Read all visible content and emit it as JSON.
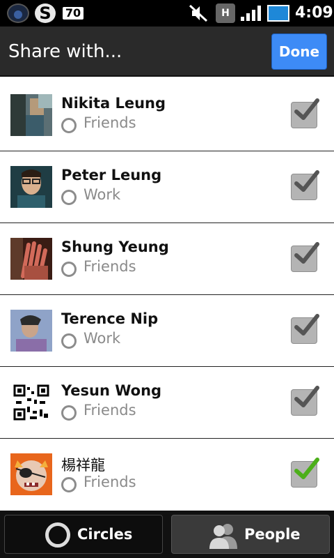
{
  "status_bar": {
    "s_icon": "S",
    "badge": "70",
    "mute_icon": "mute-icon",
    "h_label": "H",
    "time": "4:09"
  },
  "header": {
    "title": "Share with...",
    "done_label": "Done"
  },
  "contacts": [
    {
      "name": "Nikita Leung",
      "circle": "Friends",
      "checked": true,
      "check_color": "#555555"
    },
    {
      "name": "Peter Leung",
      "circle": "Work",
      "checked": true,
      "check_color": "#555555"
    },
    {
      "name": "Shung Yeung",
      "circle": "Friends",
      "checked": true,
      "check_color": "#555555"
    },
    {
      "name": "Terence Nip",
      "circle": "Work",
      "checked": true,
      "check_color": "#555555"
    },
    {
      "name": "Yesun Wong",
      "circle": "Friends",
      "checked": true,
      "check_color": "#555555"
    },
    {
      "name": "楊祥龍",
      "circle": "Friends",
      "checked": true,
      "check_color": "#4caf1a"
    }
  ],
  "tabs": {
    "circles_label": "Circles",
    "people_label": "People"
  },
  "colors": {
    "accent_done": "#3d8bf6",
    "battery": "#1e88d8"
  }
}
